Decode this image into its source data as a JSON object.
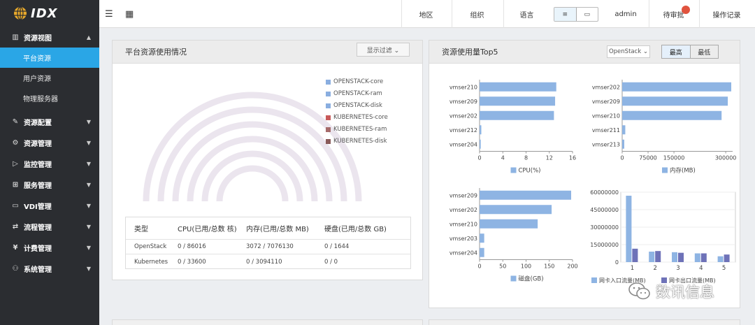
{
  "logo": {
    "text": "IDX"
  },
  "sidebar": {
    "groups": [
      {
        "label": "资源视图",
        "icon": "chart-icon",
        "expanded": true,
        "items": [
          {
            "label": "平台资源",
            "active": true
          },
          {
            "label": "用户资源"
          },
          {
            "label": "物理服务器"
          }
        ]
      },
      {
        "label": "资源配置",
        "icon": "pen-icon"
      },
      {
        "label": "资源管理",
        "icon": "gear-icon"
      },
      {
        "label": "监控管理",
        "icon": "monitor-icon"
      },
      {
        "label": "服务管理",
        "icon": "grid-icon"
      },
      {
        "label": "VDI管理",
        "icon": "desktop-icon"
      },
      {
        "label": "流程管理",
        "icon": "flow-icon"
      },
      {
        "label": "计费管理",
        "icon": "yen-icon"
      },
      {
        "label": "系统管理",
        "icon": "users-icon"
      }
    ]
  },
  "topbar": {
    "items": [
      "地区",
      "组织",
      "语言"
    ],
    "user": "admin",
    "pending": "待审批",
    "log": "操作记录",
    "view_list": "≡",
    "view_card": "▭"
  },
  "platform_panel": {
    "title": "平台资源使用情况",
    "filter_label": "显示过滤 ⌄",
    "legend": [
      {
        "label": "OPENSTACK-core",
        "color": "#8aaee0"
      },
      {
        "label": "OPENSTACK-ram",
        "color": "#8aaee0"
      },
      {
        "label": "OPENSTACK-disk",
        "color": "#8aaee0"
      },
      {
        "label": "KUBERNETES-core",
        "color": "#c85a5a"
      },
      {
        "label": "KUBERNETES-ram",
        "color": "#a66b6b"
      },
      {
        "label": "KUBERNETES-disk",
        "color": "#8a5a5a"
      }
    ],
    "table": {
      "headers": [
        "类型",
        "CPU(已用/总数 核)",
        "内存(已用/总数 MB)",
        "硬盘(已用/总数 GB)"
      ],
      "rows": [
        [
          "OpenStack",
          "0 / 86016",
          "3072 / 7076130",
          "0 / 1644"
        ],
        [
          "Kubernetes",
          "0 / 33600",
          "0 / 3094110",
          "0 / 0"
        ]
      ]
    }
  },
  "top5_panel": {
    "title": "资源使用量Top5",
    "select_value": "OpenStack ⌄",
    "seg_high": "最高",
    "seg_low": "最低"
  },
  "chart_data": [
    {
      "type": "bar",
      "orientation": "horizontal",
      "categories": [
        "vmser210",
        "vmser209",
        "vmser202",
        "vmser212",
        "vmser204"
      ],
      "values": [
        13.2,
        13.0,
        12.8,
        0.3,
        0.2
      ],
      "xlim": [
        0,
        16
      ],
      "xticks": [
        "0",
        "4",
        "8",
        "12",
        "16"
      ],
      "legend": "CPU(%)",
      "color": "#8eb4e3"
    },
    {
      "type": "bar",
      "orientation": "horizontal",
      "categories": [
        "vmser202",
        "vmser209",
        "vmser210",
        "vmser211",
        "vmser213"
      ],
      "values": [
        316000,
        306000,
        288000,
        9000,
        6000
      ],
      "xlim": [
        0,
        320000
      ],
      "xticks": [
        "0",
        "75000",
        "150000",
        "300000"
      ],
      "xtick_values": [
        0,
        75000,
        150000,
        300000
      ],
      "legend": "内存(MB)",
      "color": "#8eb4e3"
    },
    {
      "type": "bar",
      "orientation": "horizontal",
      "categories": [
        "vmser209",
        "vmser202",
        "vmser210",
        "vmser203",
        "vmser204"
      ],
      "values": [
        197,
        155,
        125,
        10,
        10
      ],
      "xlim": [
        0,
        200
      ],
      "xticks": [
        "0",
        "50",
        "100",
        "150",
        "200"
      ],
      "legend": "磁盘(GB)",
      "color": "#8eb4e3"
    },
    {
      "type": "bar",
      "orientation": "vertical",
      "categories": [
        "1",
        "2",
        "3",
        "4",
        "5"
      ],
      "series": [
        {
          "name": "网卡入口流量(MB)",
          "values": [
            57000000,
            9000000,
            8500000,
            7500000,
            5000000
          ],
          "color": "#8eb4e3"
        },
        {
          "name": "网卡出口流量(MB)",
          "values": [
            11500000,
            9500000,
            8000000,
            7500000,
            6500000
          ],
          "color": "#6e72b8"
        }
      ],
      "ylim": [
        0,
        60000000
      ],
      "yticks": [
        "0",
        "15000000",
        "30000000",
        "45000000",
        "60000000"
      ]
    }
  ],
  "watermark": {
    "text": "数讯信息"
  }
}
